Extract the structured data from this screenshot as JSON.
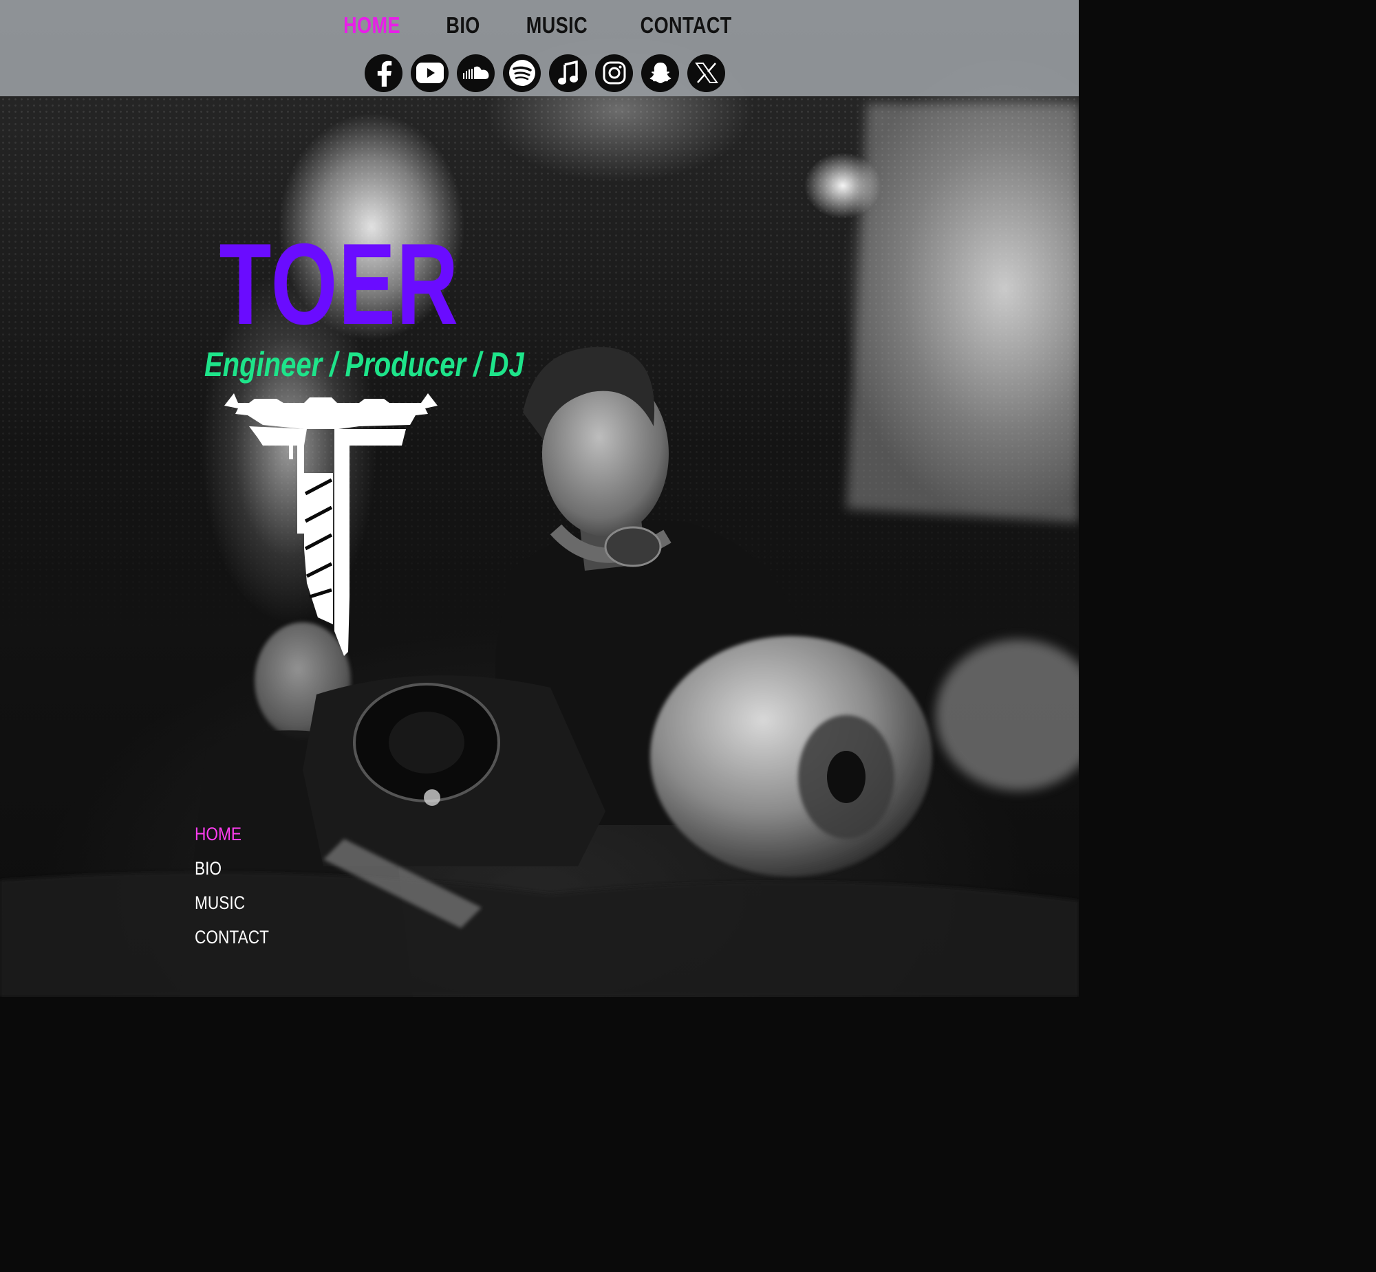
{
  "colors": {
    "accent_nav": "#e81ee8",
    "title": "#6a0cff",
    "subtitle": "#1ee48a",
    "header_bg": "#969a9e",
    "icon_bg": "#0c0c0c"
  },
  "top_nav": {
    "items": [
      {
        "label": "HOME",
        "active": true
      },
      {
        "label": "BIO",
        "active": false
      },
      {
        "label": "MUSIC",
        "active": false
      },
      {
        "label": "CONTACT",
        "active": false
      }
    ]
  },
  "social": {
    "icons": [
      "facebook-icon",
      "youtube-icon",
      "soundcloud-icon",
      "spotify-icon",
      "apple-music-icon",
      "instagram-icon",
      "snapchat-icon",
      "x-icon"
    ]
  },
  "hero": {
    "title": "TOER",
    "subtitle": "Engineer / Producer / DJ"
  },
  "bottom_nav": {
    "items": [
      {
        "label": "HOME",
        "active": true
      },
      {
        "label": "BIO",
        "active": false
      },
      {
        "label": "MUSIC",
        "active": false
      },
      {
        "label": "CONTACT",
        "active": false
      }
    ]
  }
}
